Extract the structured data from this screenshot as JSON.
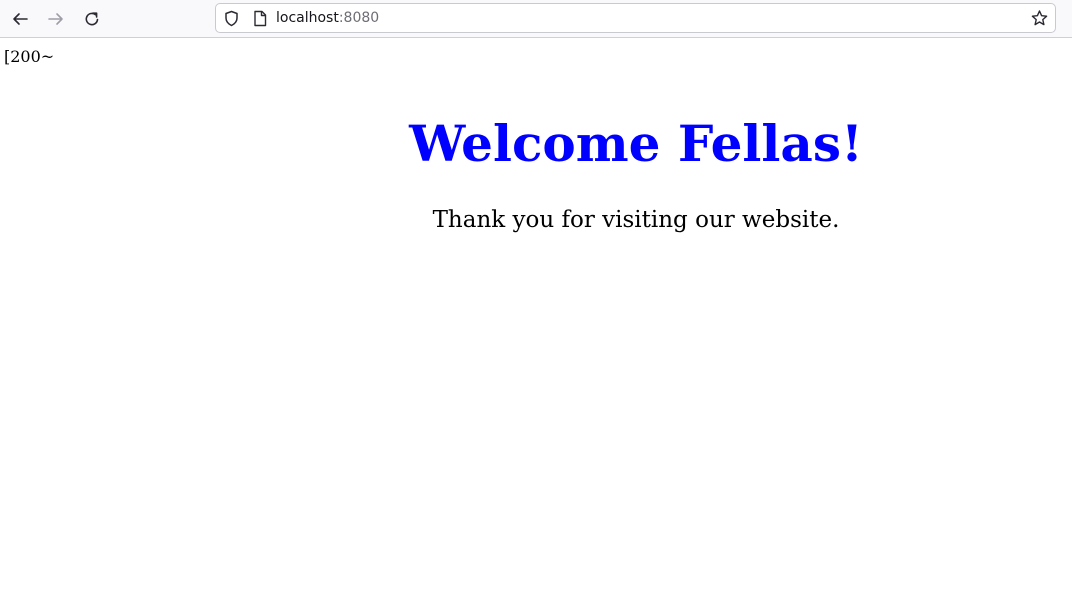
{
  "browser": {
    "url_host": "localhost",
    "url_port": ":8080",
    "icons": {
      "back": "back-arrow-icon",
      "forward": "forward-arrow-icon",
      "reload": "reload-icon",
      "security": "shield-icon",
      "page": "page-icon",
      "bookmark": "star-icon"
    }
  },
  "page": {
    "stray_text": "[200~",
    "heading": "Welcome Fellas!",
    "subtext": "Thank you for visiting our website.",
    "heading_color": "#0000ff"
  }
}
